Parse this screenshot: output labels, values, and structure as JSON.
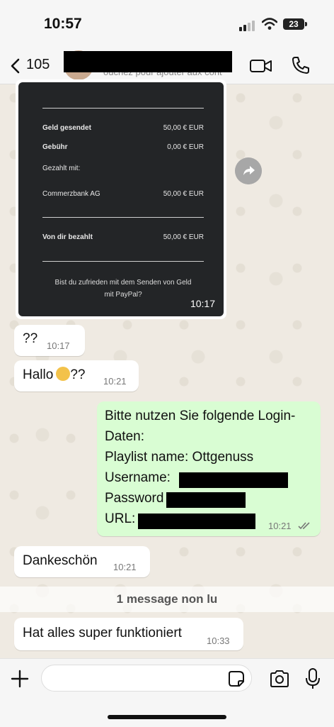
{
  "status_bar": {
    "time": "10:57",
    "battery": "23"
  },
  "header": {
    "back_count": "105",
    "subtitle": "ouchez pour ajouter aux cont"
  },
  "receipt": {
    "rows": [
      {
        "label": "Geld gesendet",
        "value": "50,00 € EUR"
      },
      {
        "label": "Gebühr",
        "value": "0,00 € EUR"
      },
      {
        "label": "Gezahlt mit:",
        "value": ""
      },
      {
        "label": "Commerzbank AG",
        "value": "50,00 € EUR"
      },
      {
        "label": "Von dir bezahlt",
        "value": "50,00 € EUR"
      }
    ],
    "footer_line1": "Bist du zufrieden mit dem Senden von Geld",
    "footer_line2": "mit PayPal?",
    "time": "10:17"
  },
  "messages": [
    {
      "text": "??",
      "time": "10:17"
    },
    {
      "text": "Hallo",
      "text_after": "??",
      "time": "10:21"
    },
    {
      "lines": [
        "Bitte nutzen Sie folgende Login-",
        "Daten:",
        "Playlist name: Ottgenuss",
        "Username:",
        "Password",
        "URL:"
      ],
      "time": "10:21"
    },
    {
      "text": "Dankeschön",
      "time": "10:21"
    },
    {
      "text": "Hat alles super funktioniert",
      "time": "10:33"
    }
  ],
  "unread_banner": "1 message non lu",
  "composer": {
    "placeholder": ""
  }
}
